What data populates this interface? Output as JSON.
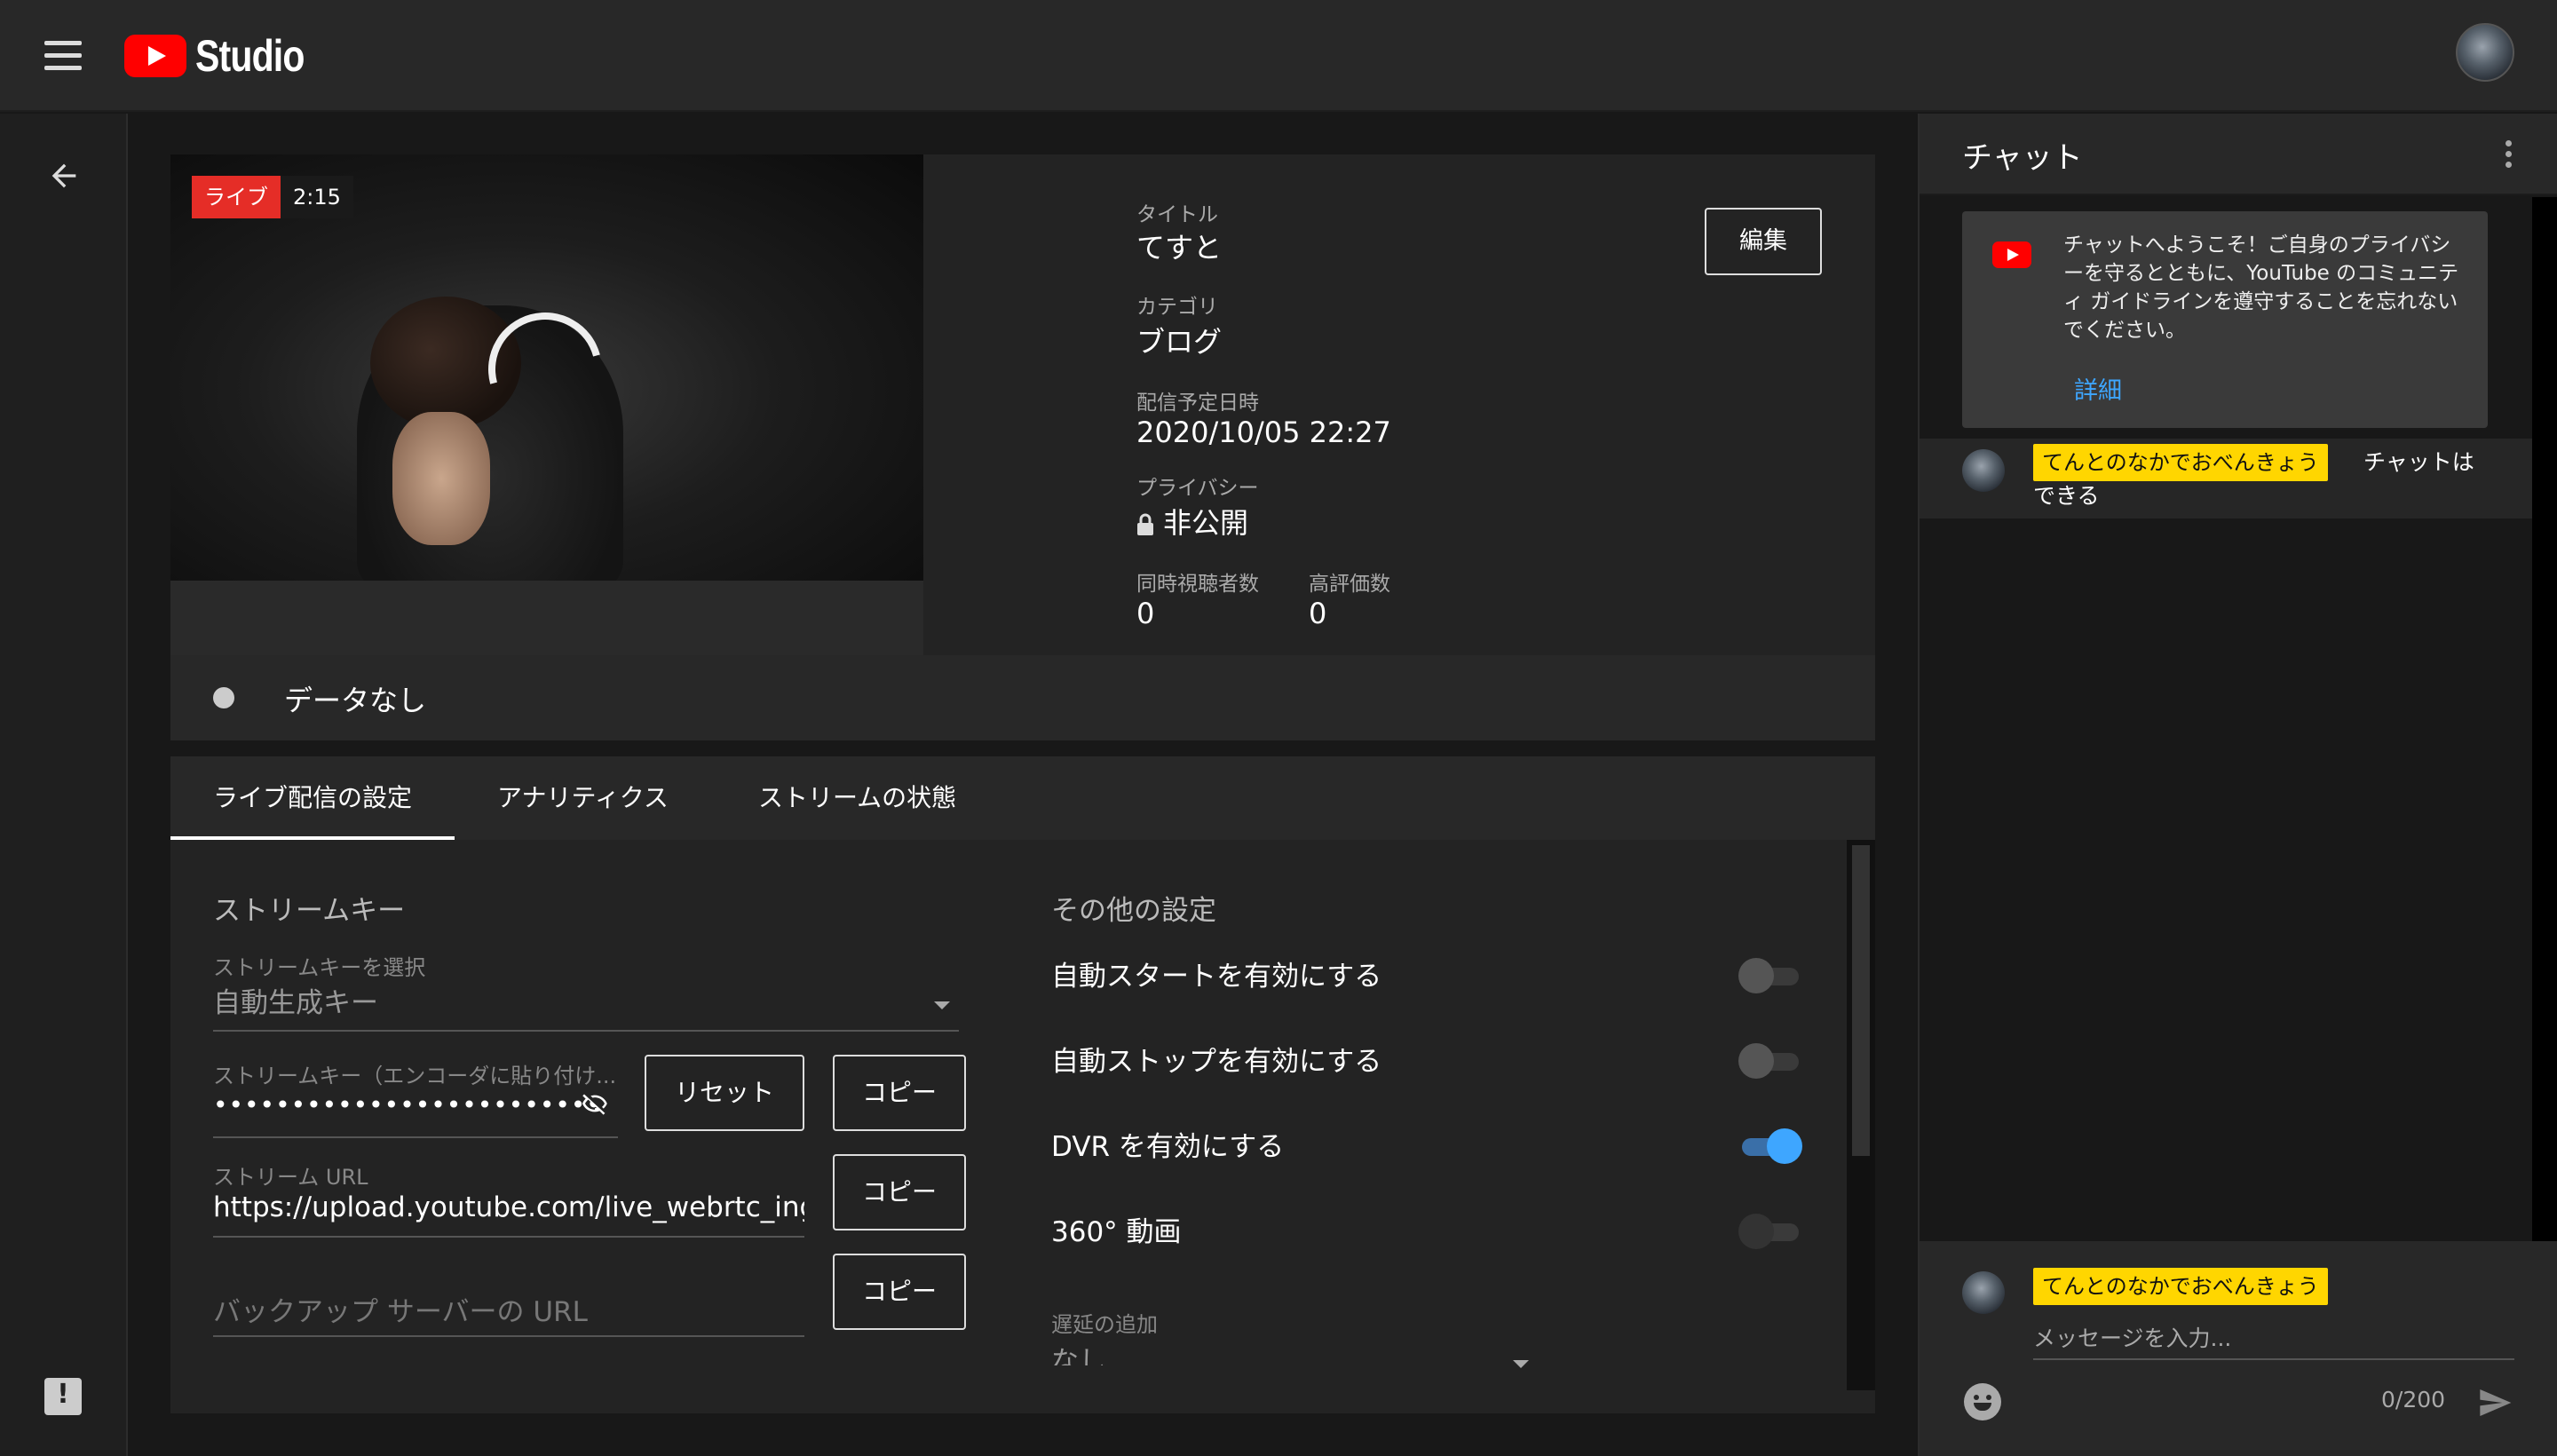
{
  "header": {
    "logo_text": "Studio"
  },
  "video": {
    "live_tag": "ライブ",
    "elapsed": "2:15"
  },
  "info": {
    "title_label": "タイトル",
    "title_value": "てすと",
    "category_label": "カテゴリ",
    "category_value": "ブログ",
    "schedule_label": "配信予定日時",
    "schedule_value": "2020/10/05 22:27",
    "privacy_label": "プライバシー",
    "privacy_value": "非公開",
    "viewers_label": "同時視聴者数",
    "viewers_value": "0",
    "likes_label": "高評価数",
    "likes_value": "0",
    "edit_label": "編集"
  },
  "status": {
    "text": "データなし"
  },
  "tabs": [
    {
      "label": "ライブ配信の設定",
      "active": true
    },
    {
      "label": "アナリティクス",
      "active": false
    },
    {
      "label": "ストリームの状態",
      "active": false
    }
  ],
  "stream_key": {
    "section_title": "ストリームキー",
    "select_label": "ストリームキーを選択",
    "select_value": "自動生成キー",
    "key_label": "ストリームキー（エンコーダに貼り付け...",
    "key_value": "••••••••••••••••••••••••",
    "reset_label": "リセット",
    "copy_label": "コピー",
    "url_label": "ストリーム URL",
    "url_value": "https://upload.youtube.com/live_webrtc_ingest",
    "backup_placeholder": "バックアップ サーバーの URL"
  },
  "other_settings": {
    "section_title": "その他の設定",
    "toggles": [
      {
        "label": "自動スタートを有効にする",
        "on": false
      },
      {
        "label": "自動ストップを有効にする",
        "on": false
      },
      {
        "label": "DVR を有効にする",
        "on": true
      },
      {
        "label": "360° 動画",
        "on": false
      }
    ],
    "latency_label": "遅延の追加",
    "latency_value": "なし"
  },
  "chat": {
    "title": "チャット",
    "welcome_text": "チャットへようこそ！ご自身のプライバシーを守るとともに、YouTube のコミュニティ ガイドラインを遵守することを忘れないでください。",
    "welcome_link": "詳細",
    "messages": [
      {
        "author": "てんとのなかでおべんきょう",
        "text_line1": "チャットは",
        "text_line2": "できる"
      }
    ],
    "input_author": "てんとのなかでおべんきょう",
    "input_placeholder": "メッセージを入力...",
    "counter": "0/200"
  },
  "colors": {
    "accent_blue": "#3ea6ff",
    "live_red": "#e52d27",
    "author_chip": "#ffd600"
  }
}
